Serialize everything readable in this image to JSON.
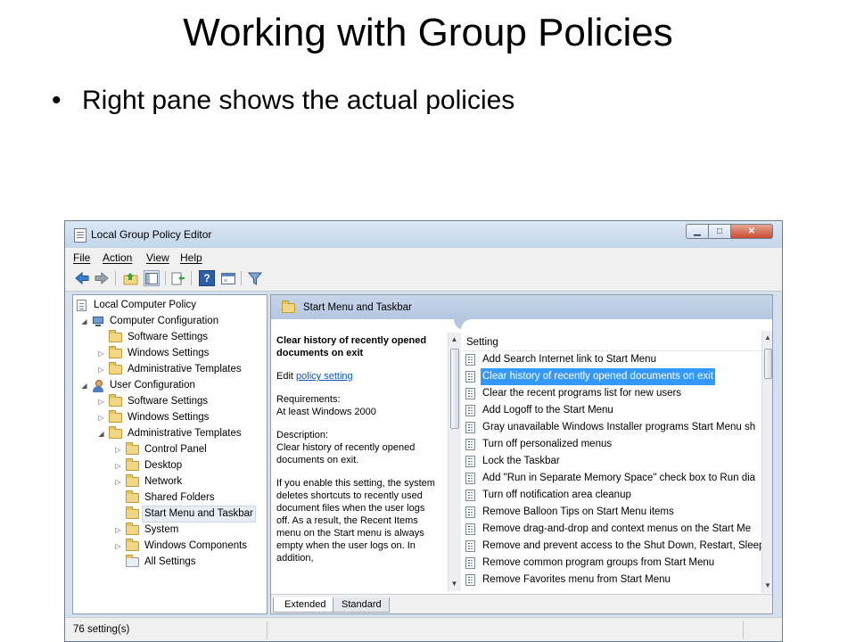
{
  "slide": {
    "title": "Working with Group Policies",
    "bullet": "Right pane shows the actual policies"
  },
  "window": {
    "title": "Local Group Policy Editor",
    "controls": {
      "minimize": "▁",
      "maximize": "□",
      "close": "✕"
    }
  },
  "menubar": [
    "File",
    "Action",
    "View",
    "Help"
  ],
  "toolbar": {
    "icons": [
      "back-arrow-icon",
      "forward-arrow-icon",
      "up-folder-icon",
      "show-hide-tree-icon",
      "export-list-icon",
      "help-icon",
      "properties-icon",
      "filter-icon"
    ],
    "help_glyph": "?"
  },
  "tree": {
    "expander_open": "◢",
    "expander_closed": "▷",
    "nodes": [
      {
        "label": "Local Computer Policy"
      },
      {
        "label": "Computer Configuration"
      },
      {
        "label": "Software Settings"
      },
      {
        "label": "Windows Settings"
      },
      {
        "label": "Administrative Templates"
      },
      {
        "label": "User Configuration"
      },
      {
        "label": "Software Settings"
      },
      {
        "label": "Windows Settings"
      },
      {
        "label": "Administrative Templates"
      },
      {
        "label": "Control Panel"
      },
      {
        "label": "Desktop"
      },
      {
        "label": "Network"
      },
      {
        "label": "Shared Folders"
      },
      {
        "label": "Start Menu and Taskbar"
      },
      {
        "label": "System"
      },
      {
        "label": "Windows Components"
      },
      {
        "label": "All Settings"
      }
    ]
  },
  "right_pane": {
    "header": "Start Menu and Taskbar",
    "description": {
      "title": "Clear history of recently opened documents on exit",
      "edit_prefix": "Edit",
      "edit_link": "policy setting",
      "requirements_label": "Requirements:",
      "requirements_value": "At least Windows 2000",
      "description_label": "Description:",
      "description_value": "Clear history of recently opened documents on exit.",
      "body": "If you enable this setting, the system deletes shortcuts to recently used document files when the user logs off. As a result, the Recent Items menu on the Start menu is always empty when the user logs on. In addition,"
    },
    "column_header": "Setting",
    "settings": [
      "Add Search Internet link to Start Menu",
      "Clear history of recently opened documents on exit",
      "Clear the recent programs list for new users",
      "Add Logoff to the Start Menu",
      "Gray unavailable Windows Installer programs Start Menu sh",
      "Turn off personalized menus",
      "Lock the Taskbar",
      "Add \"Run in Separate Memory Space\" check box to Run dia",
      "Turn off notification area cleanup",
      "Remove Balloon Tips on Start Menu items",
      "Remove drag-and-drop and context menus on the Start Me",
      "Remove and prevent access to the Shut Down, Restart, Sleep",
      "Remove common program groups from Start Menu",
      "Remove Favorites menu from Start Menu"
    ],
    "selected_setting_index": 1,
    "tabs": [
      "Extended",
      "Standard"
    ]
  },
  "statusbar": {
    "text": "76 setting(s)"
  },
  "colors": {
    "selection": "#3399ff",
    "link": "#0b58c2",
    "header_band": "#b4c7e1"
  }
}
